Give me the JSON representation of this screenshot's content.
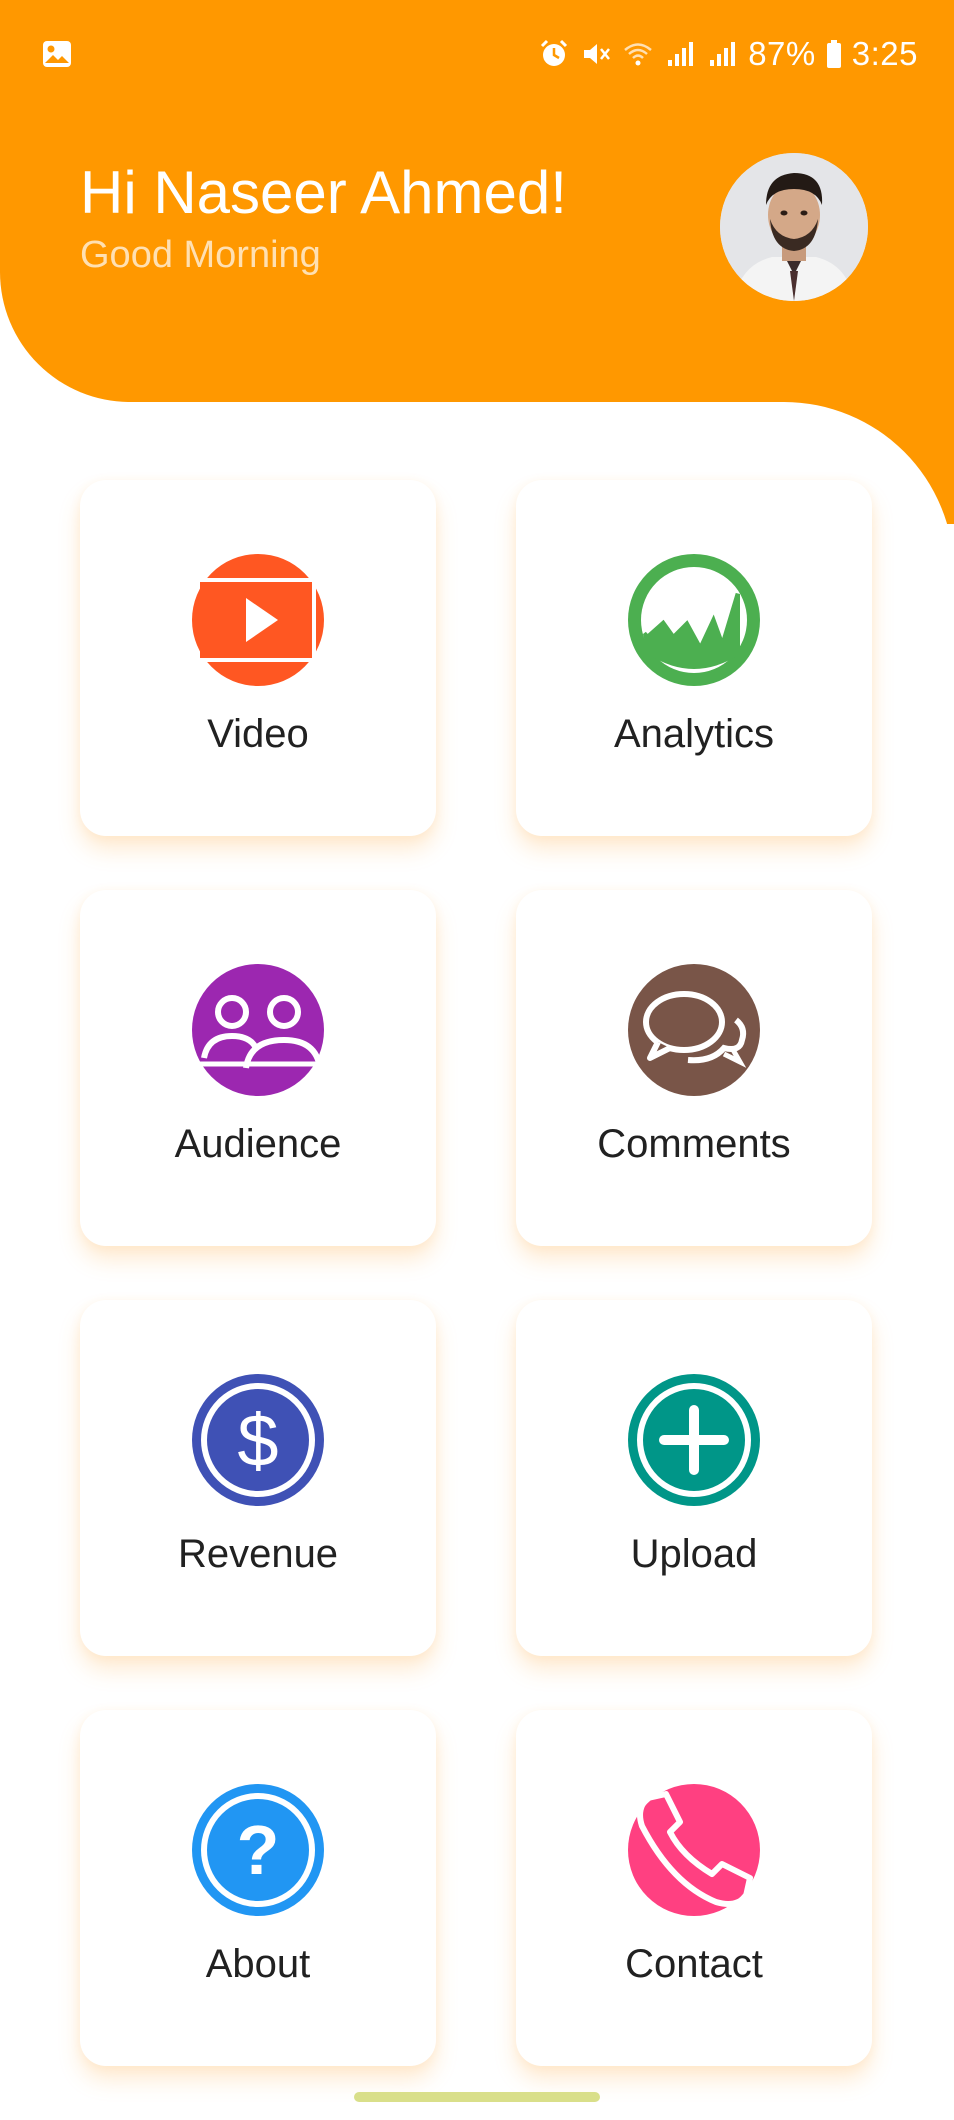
{
  "status_bar": {
    "battery": "87%",
    "time": "3:25"
  },
  "header": {
    "greeting": "Hi Naseer Ahmed!",
    "subgreeting": "Good Morning"
  },
  "menu": [
    {
      "label": "Video",
      "icon": "video-play-icon",
      "color": "#FF5722"
    },
    {
      "label": "Analytics",
      "icon": "analytics-chart-icon",
      "color": "#4CAF50"
    },
    {
      "label": "Audience",
      "icon": "audience-people-icon",
      "color": "#9C27B0"
    },
    {
      "label": "Comments",
      "icon": "comments-bubbles-icon",
      "color": "#795548"
    },
    {
      "label": "Revenue",
      "icon": "dollar-icon",
      "color": "#3F51B5"
    },
    {
      "label": "Upload",
      "icon": "plus-icon",
      "color": "#009688"
    },
    {
      "label": "About",
      "icon": "question-icon",
      "color": "#2196F3"
    },
    {
      "label": "Contact",
      "icon": "phone-icon",
      "color": "#FF4081"
    }
  ],
  "theme": {
    "header_color": "#FF9800"
  }
}
